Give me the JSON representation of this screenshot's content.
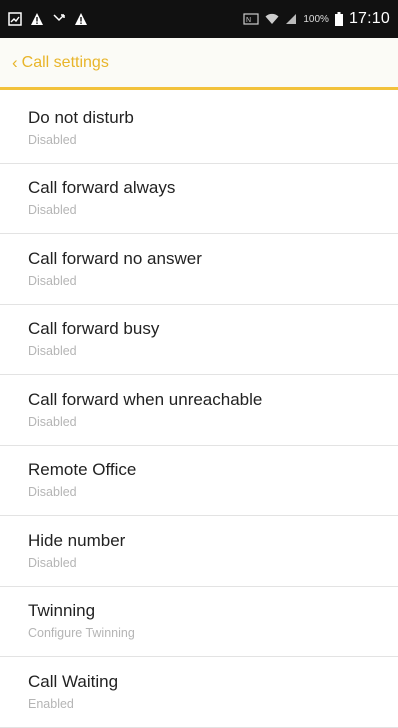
{
  "status_bar": {
    "icons_left": [
      "gallery-icon",
      "warning-icon",
      "missed-call-icon",
      "warning-icon"
    ],
    "icons_right": [
      "nfc-icon",
      "wifi-icon",
      "signal-icon",
      "battery-icon"
    ],
    "battery": "100%",
    "time": "17:10"
  },
  "action_bar": {
    "back_glyph": "‹",
    "title": "Call settings",
    "accent_color": "#e8b52a"
  },
  "settings": [
    {
      "title": "Do not disturb",
      "subtitle": "Disabled"
    },
    {
      "title": "Call forward always",
      "subtitle": "Disabled"
    },
    {
      "title": "Call forward no answer",
      "subtitle": "Disabled"
    },
    {
      "title": "Call forward busy",
      "subtitle": "Disabled"
    },
    {
      "title": "Call forward when unreachable",
      "subtitle": "Disabled"
    },
    {
      "title": "Remote Office",
      "subtitle": "Disabled"
    },
    {
      "title": "Hide number",
      "subtitle": "Disabled"
    },
    {
      "title": "Twinning",
      "subtitle": "Configure Twinning"
    },
    {
      "title": "Call Waiting",
      "subtitle": "Enabled"
    }
  ]
}
